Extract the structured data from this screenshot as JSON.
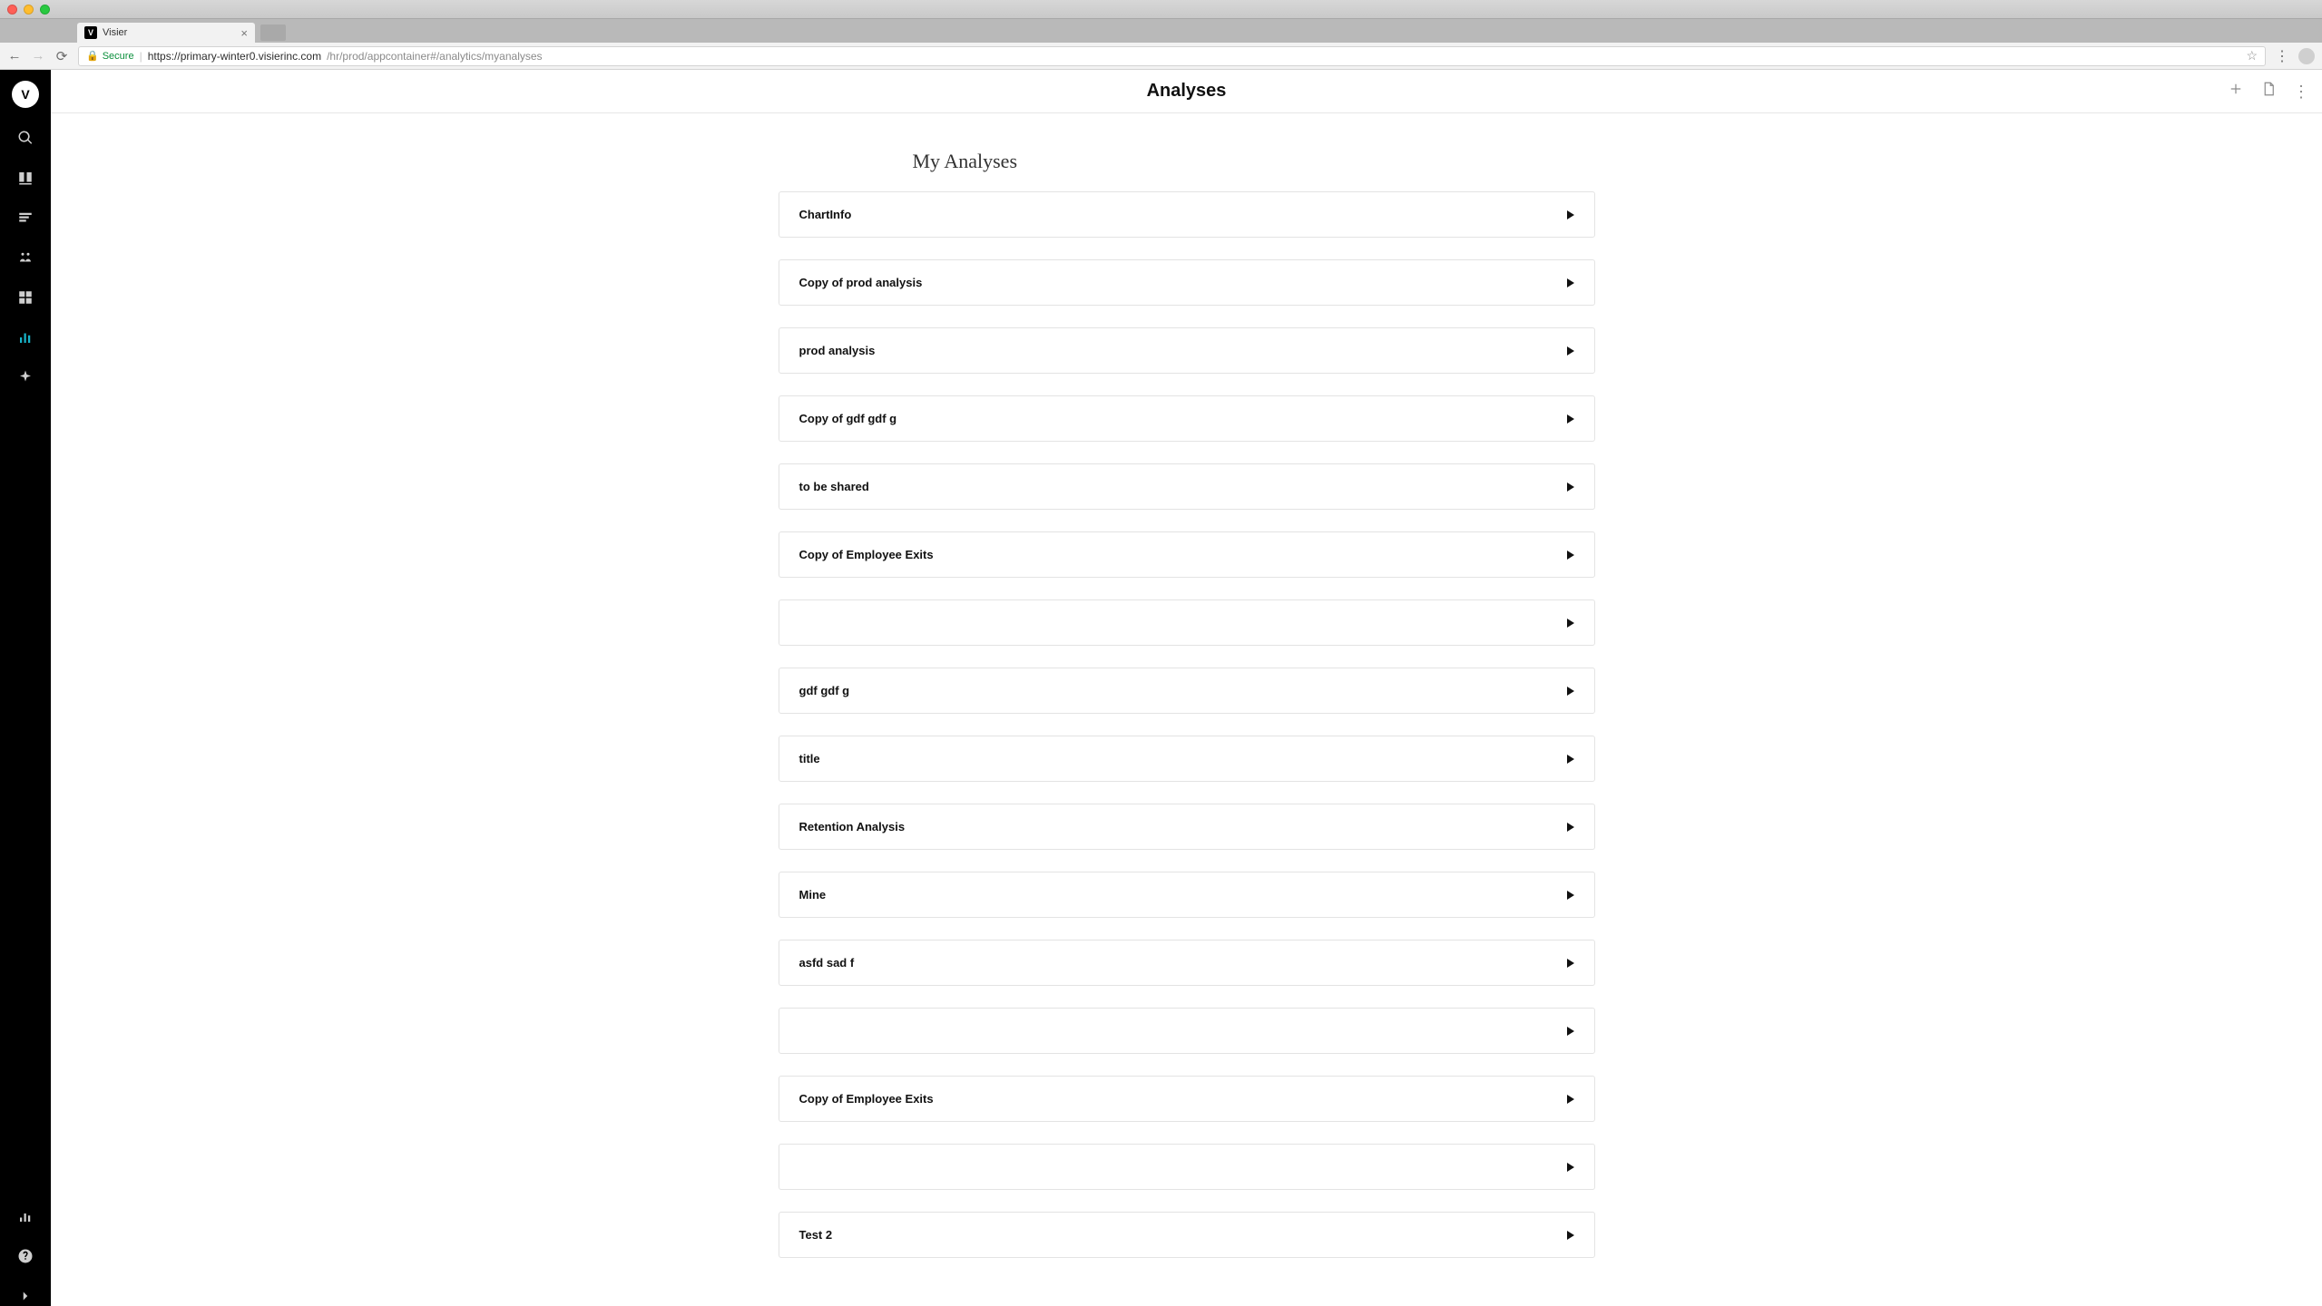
{
  "browser": {
    "tab_title": "Visier",
    "secure_label": "Secure",
    "url_host": "https://primary-winter0.visierinc.com",
    "url_path": "/hr/prod/appcontainer#/analytics/myanalyses"
  },
  "sidebar": {
    "logo_letter": "V"
  },
  "header": {
    "title": "Analyses"
  },
  "main": {
    "section_title": "My Analyses",
    "analyses": [
      {
        "title": "ChartInfo"
      },
      {
        "title": "Copy of prod analysis"
      },
      {
        "title": "prod analysis"
      },
      {
        "title": "Copy of gdf gdf g"
      },
      {
        "title": "to be shared"
      },
      {
        "title": "Copy of Employee Exits"
      },
      {
        "title": ""
      },
      {
        "title": "gdf gdf g"
      },
      {
        "title": "title"
      },
      {
        "title": "Retention Analysis"
      },
      {
        "title": "Mine"
      },
      {
        "title": "asfd sad f"
      },
      {
        "title": ""
      },
      {
        "title": "Copy of Employee Exits"
      },
      {
        "title": ""
      },
      {
        "title": "Test 2"
      }
    ]
  }
}
